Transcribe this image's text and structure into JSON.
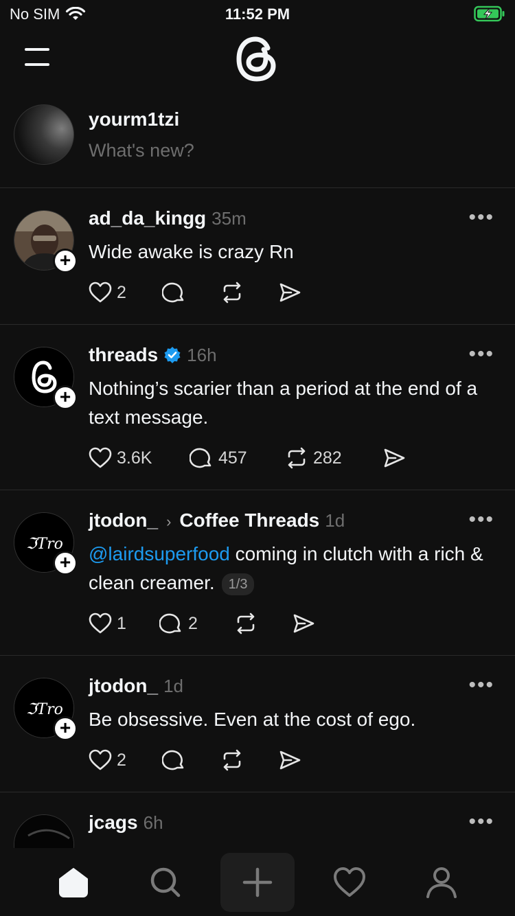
{
  "status_bar": {
    "carrier": "No SIM",
    "time": "11:52 PM"
  },
  "composer": {
    "username": "yourm1tzi",
    "placeholder": "What's new?"
  },
  "posts": [
    {
      "username": "ad_da_kingg",
      "time": "35m",
      "text": "Wide awake is crazy Rn",
      "likes": "2",
      "replies": "",
      "reposts": ""
    },
    {
      "username": "threads",
      "verified": true,
      "time": "16h",
      "text": "Nothing’s scarier than a period at the end of a text message.",
      "likes": "3.6K",
      "replies": "457",
      "reposts": "282"
    },
    {
      "username": "jtodon_",
      "community": "Coffee Threads",
      "time": "1d",
      "mention": "@lairdsuperfood",
      "text": " coming in clutch with a rich & clean creamer.",
      "pager": "1/3",
      "likes": "1",
      "replies": "2",
      "reposts": ""
    },
    {
      "username": "jtodon_",
      "time": "1d",
      "text": "Be obsessive. Even at the cost of ego.",
      "likes": "2",
      "replies": "",
      "reposts": ""
    },
    {
      "username": "jcags",
      "time": "6h",
      "text": ""
    }
  ],
  "avatar_monogram": "ℑTro",
  "colors": {
    "background": "#101010",
    "accent_link": "#1d9bf0",
    "battery": "#34c759"
  },
  "tabs": [
    "home-icon",
    "search-icon",
    "compose-icon",
    "activity-icon",
    "profile-icon"
  ]
}
